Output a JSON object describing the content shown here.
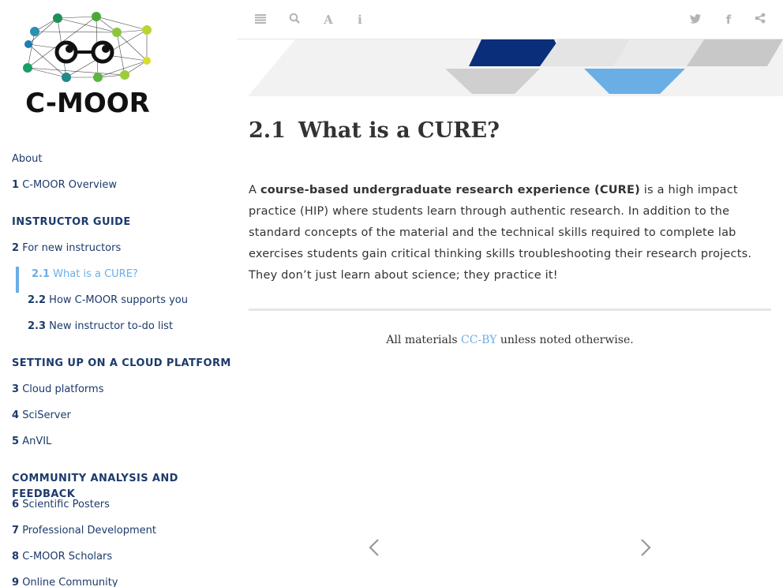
{
  "logo": {
    "text": "C-MOOR"
  },
  "sidebar": {
    "items": [
      {
        "label": "About"
      },
      {
        "num": "1",
        "label": "C-MOOR Overview"
      }
    ],
    "sections": [
      {
        "header": "INSTRUCTOR GUIDE",
        "items": [
          {
            "num": "2",
            "label": "For new instructors"
          },
          {
            "num": "2.1",
            "label": "What is a CURE?",
            "active": true
          },
          {
            "num": "2.2",
            "label": "How C-MOOR supports you"
          },
          {
            "num": "2.3",
            "label": "New instructor to-do list"
          }
        ]
      },
      {
        "header": "SETTING UP ON A CLOUD PLATFORM",
        "items": [
          {
            "num": "3",
            "label": "Cloud platforms"
          },
          {
            "num": "4",
            "label": "SciServer"
          },
          {
            "num": "5",
            "label": "AnVIL"
          }
        ]
      },
      {
        "header": "COMMUNITY ANALYSIS AND FEEDBACK",
        "items": [
          {
            "num": "6",
            "label": "Scientific Posters"
          },
          {
            "num": "7",
            "label": "Professional Development"
          },
          {
            "num": "8",
            "label": "C-MOOR Scholars"
          },
          {
            "num": "9",
            "label": "Online Community"
          }
        ]
      }
    ]
  },
  "toolbar": {
    "left_icons": [
      "toc-icon",
      "search-icon",
      "font-icon",
      "info-icon"
    ],
    "right_icons": [
      "twitter-icon",
      "facebook-icon",
      "share-icon"
    ]
  },
  "content": {
    "section_number": "2.1",
    "title": "What is a CURE?",
    "para_prefix": "A ",
    "para_bold": "course-based undergraduate research experience (CURE)",
    "para_rest": " is a high impact practice (HIP) where students learn through authentic research. In addition to the standard concepts of the material and the technical skills required to complete lab exercises students gain critical thinking skills troubleshooting their research projects. They don’t just learn about science; they practice it!",
    "footer_prefix": "All materials ",
    "footer_link": "CC-BY",
    "footer_suffix": " unless noted otherwise."
  },
  "colors": {
    "nav_text": "#1c3a6b",
    "active": "#6aaee6",
    "banner_dark": "#0a2e7a",
    "banner_light_blue": "#6aaee6"
  }
}
